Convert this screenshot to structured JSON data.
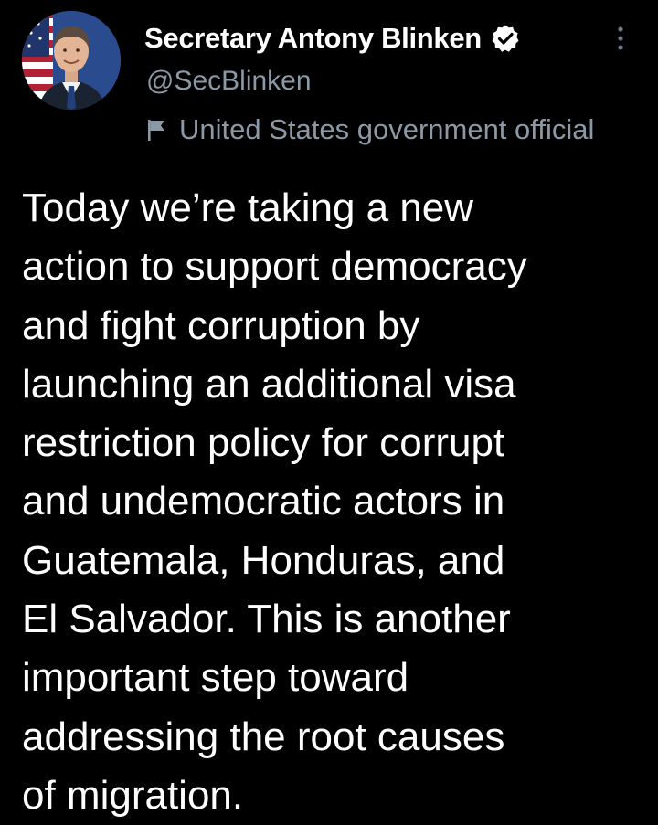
{
  "author": {
    "display_name": "Secretary Antony Blinken",
    "handle": "@SecBlinken",
    "label": "United States government official",
    "verified": true,
    "avatar_icon": "profile-photo-avatar",
    "flag_icon": "flag-icon",
    "badge_icon": "verified-badge-icon"
  },
  "tweet": {
    "lines": [
      "Today we’re taking a new",
      "action to support democracy",
      "and fight corruption by",
      "launching an additional visa",
      "restriction policy for corrupt",
      "and undemocratic actors in",
      "Guatemala, Honduras, and",
      "El Salvador. This is another",
      "important step toward",
      "addressing the root causes",
      "of migration."
    ]
  },
  "colors": {
    "background": "#000000",
    "text_primary": "#ffffff",
    "text_secondary": "#8b98a5"
  }
}
